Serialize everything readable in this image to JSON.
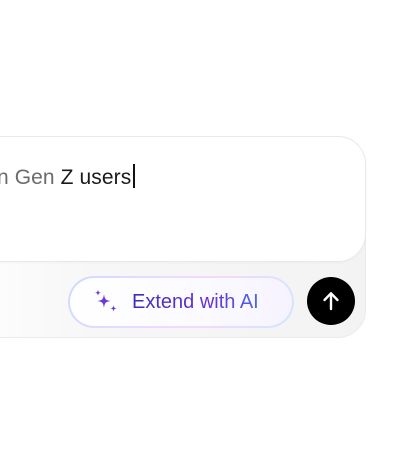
{
  "composer": {
    "prompt_faded": "n Gen ",
    "prompt_strong": "Z users"
  },
  "actions": {
    "extend_label": "Extend with AI",
    "extend_icon": "sparkles-icon",
    "send_icon": "arrow-up-icon"
  },
  "colors": {
    "send_button": "#000000",
    "extend_text_start": "#3b2fb8",
    "extend_text_end": "#4a67ea",
    "sparkle": "#6a35d6"
  }
}
